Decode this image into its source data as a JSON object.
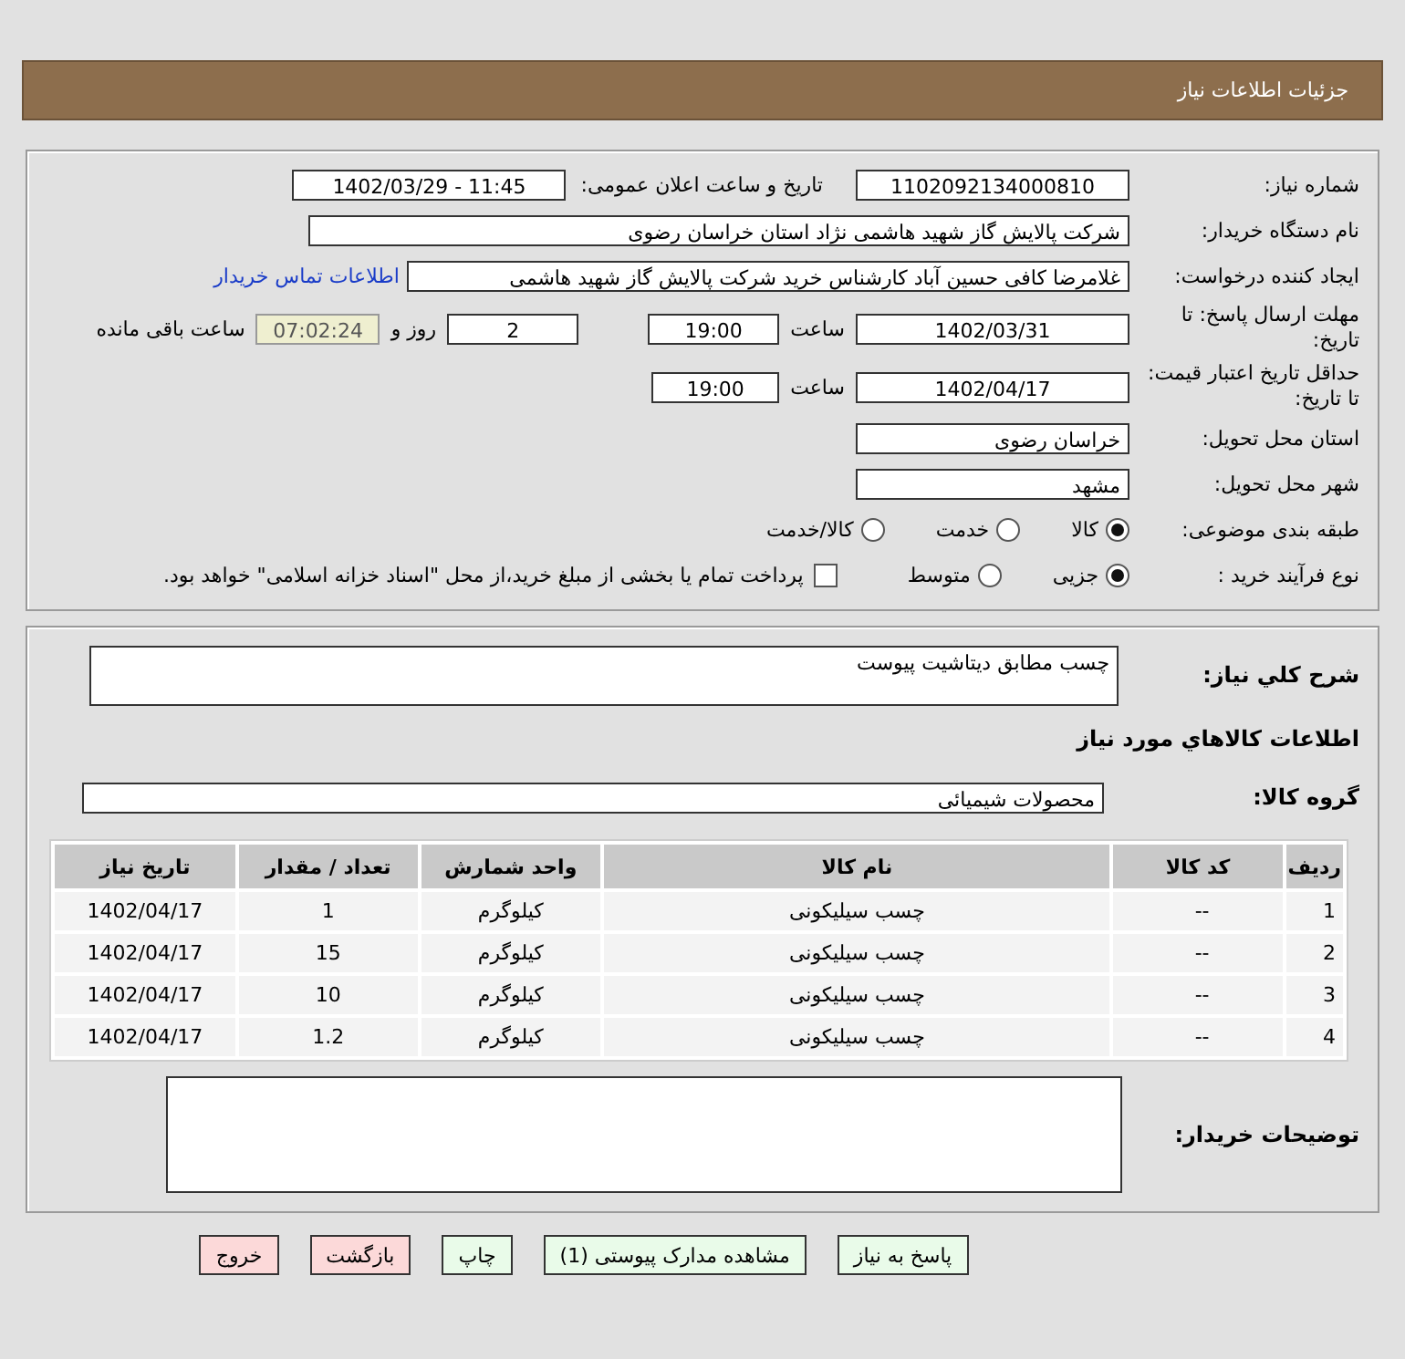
{
  "page_title": "جزئیات اطلاعات نیاز",
  "need_number": {
    "label": "شماره نیاز:",
    "value": "1102092134000810"
  },
  "announce": {
    "label": "تاریخ و ساعت اعلان عمومی:",
    "value": "1402/03/29 - 11:45"
  },
  "buyer": {
    "label": "نام دستگاه خریدار:",
    "value": "شرکت پالایش گاز شهید هاشمی نژاد   استان خراسان رضوی"
  },
  "requester": {
    "label": "ایجاد کننده درخواست:",
    "value": "غلامرضا کافی حسین آباد کارشناس خرید  شرکت پالایش گاز شهید هاشمی",
    "link": "اطلاعات تماس خریدار"
  },
  "deadline": {
    "label": "مهلت ارسال پاسخ: تا تاریخ:",
    "date": "1402/03/31",
    "time_label": "ساعت",
    "time": "19:00",
    "days": "2",
    "days_label": "روز و",
    "remaining": "07:02:24",
    "remaining_label": "ساعت باقی مانده"
  },
  "validity": {
    "label": "حداقل تاریخ اعتبار قیمت: تا تاریخ:",
    "date": "1402/04/17",
    "time_label": "ساعت",
    "time": "19:00"
  },
  "province": {
    "label": "استان محل تحویل:",
    "value": "خراسان رضوی"
  },
  "city": {
    "label": "شهر محل تحویل:",
    "value": "مشهد"
  },
  "category": {
    "label": "طبقه بندی موضوعی:",
    "options": [
      {
        "label": "کالا",
        "selected": true
      },
      {
        "label": "خدمت",
        "selected": false
      },
      {
        "label": "کالا/خدمت",
        "selected": false
      }
    ]
  },
  "process": {
    "label": "نوع فرآیند خرید :",
    "options": [
      {
        "label": "جزیی",
        "selected": true
      },
      {
        "label": "متوسط",
        "selected": false
      }
    ],
    "payment": {
      "label": "پرداخت تمام یا بخشی از مبلغ خرید،از محل \"اسناد خزانه اسلامی\" خواهد بود.",
      "checked": false
    }
  },
  "description": {
    "label": "شرح کلي نياز:",
    "value": "چسب مطابق دیتاشیت پیوست"
  },
  "goods_heading": "اطلاعات كالاهاي مورد نياز",
  "goods_group": {
    "label": "گروه کالا:",
    "value": "محصولات شیمیائی"
  },
  "table": {
    "columns": [
      "ردیف",
      "کد کالا",
      "نام کالا",
      "واحد شمارش",
      "تعداد / مقدار",
      "تاریخ نیاز"
    ],
    "rows": [
      [
        "1",
        "--",
        "چسب سیلیکونی",
        "کیلوگرم",
        "1",
        "1402/04/17"
      ],
      [
        "2",
        "--",
        "چسب سیلیکونی",
        "کیلوگرم",
        "15",
        "1402/04/17"
      ],
      [
        "3",
        "--",
        "چسب سیلیکونی",
        "کیلوگرم",
        "10",
        "1402/04/17"
      ],
      [
        "4",
        "--",
        "چسب سیلیکونی",
        "کیلوگرم",
        "1.2",
        "1402/04/17"
      ]
    ]
  },
  "buyer_notes": {
    "label": "توضیحات خریدار:"
  },
  "buttons": [
    {
      "label": "پاسخ به نیاز",
      "kind": "normal"
    },
    {
      "label": "مشاهده مدارک پیوستی (1)",
      "kind": "normal"
    },
    {
      "label": "چاپ",
      "kind": "normal"
    },
    {
      "label": "بازگشت",
      "kind": "danger"
    },
    {
      "label": "خروج",
      "kind": "danger"
    }
  ]
}
